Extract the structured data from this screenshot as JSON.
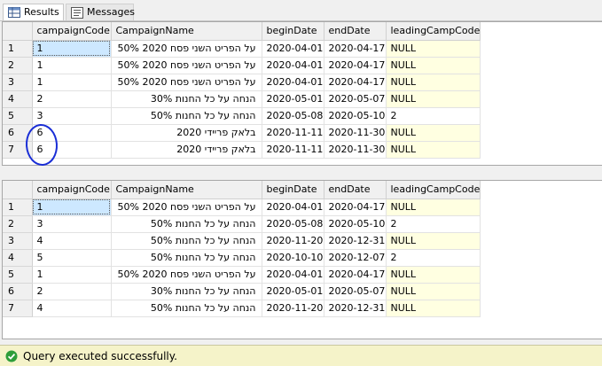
{
  "tabs": [
    {
      "label": "Results",
      "icon": "grid-icon",
      "active": true
    },
    {
      "label": "Messages",
      "icon": "messages-icon",
      "active": false
    }
  ],
  "grid1": {
    "columns": [
      "campaignCode",
      "CampaignName",
      "beginDate",
      "endDate",
      "leadingCampCode"
    ],
    "rows": [
      [
        "1",
        "1",
        "על הפריט השני פסח 2020 50%",
        "2020-04-01",
        "2020-04-17",
        "NULL"
      ],
      [
        "2",
        "1",
        "על הפריט השני פסח 2020 50%",
        "2020-04-01",
        "2020-04-17",
        "NULL"
      ],
      [
        "3",
        "1",
        "על הפריט השני פסח 2020 50%",
        "2020-04-01",
        "2020-04-17",
        "NULL"
      ],
      [
        "4",
        "2",
        "הנחה על כל החנות 30%",
        "2020-05-01",
        "2020-05-07",
        "NULL"
      ],
      [
        "5",
        "3",
        "הנחה על כל החנות 50%",
        "2020-05-08",
        "2020-05-10",
        "2"
      ],
      [
        "6",
        "6",
        "בלאק פריידי 2020",
        "2020-11-11",
        "2020-11-30",
        "NULL"
      ],
      [
        "7",
        "6",
        "בלאק פריידי 2020",
        "2020-11-11",
        "2020-11-30",
        "NULL"
      ]
    ]
  },
  "grid2": {
    "columns": [
      "campaignCode",
      "CampaignName",
      "beginDate",
      "endDate",
      "leadingCampCode"
    ],
    "rows": [
      [
        "1",
        "1",
        "על הפריט השני פסח 2020 50%",
        "2020-04-01",
        "2020-04-17",
        "NULL"
      ],
      [
        "2",
        "3",
        "הנחה על כל החנות 50%",
        "2020-05-08",
        "2020-05-10",
        "2"
      ],
      [
        "3",
        "4",
        "הנחה על כל החנות 50%",
        "2020-11-20",
        "2020-12-31",
        "NULL"
      ],
      [
        "4",
        "5",
        "הנחה על כל החנות 50%",
        "2020-10-10",
        "2020-12-07",
        "2"
      ],
      [
        "5",
        "1",
        "על הפריט השני פסח 2020 50%",
        "2020-04-01",
        "2020-04-17",
        "NULL"
      ],
      [
        "6",
        "2",
        "הנחה על כל החנות 30%",
        "2020-05-01",
        "2020-05-07",
        "NULL"
      ],
      [
        "7",
        "4",
        "הנחה על כל החנות 50%",
        "2020-11-20",
        "2020-12-31",
        "NULL"
      ]
    ]
  },
  "status": {
    "text": "Query executed successfully.",
    "icon": "check-circle-icon",
    "color": "#2e9e3a"
  },
  "colors": {
    "null_cell": "#ffffe1",
    "annotation": "#1a2ed6",
    "status_bar": "#f5f3c9"
  }
}
